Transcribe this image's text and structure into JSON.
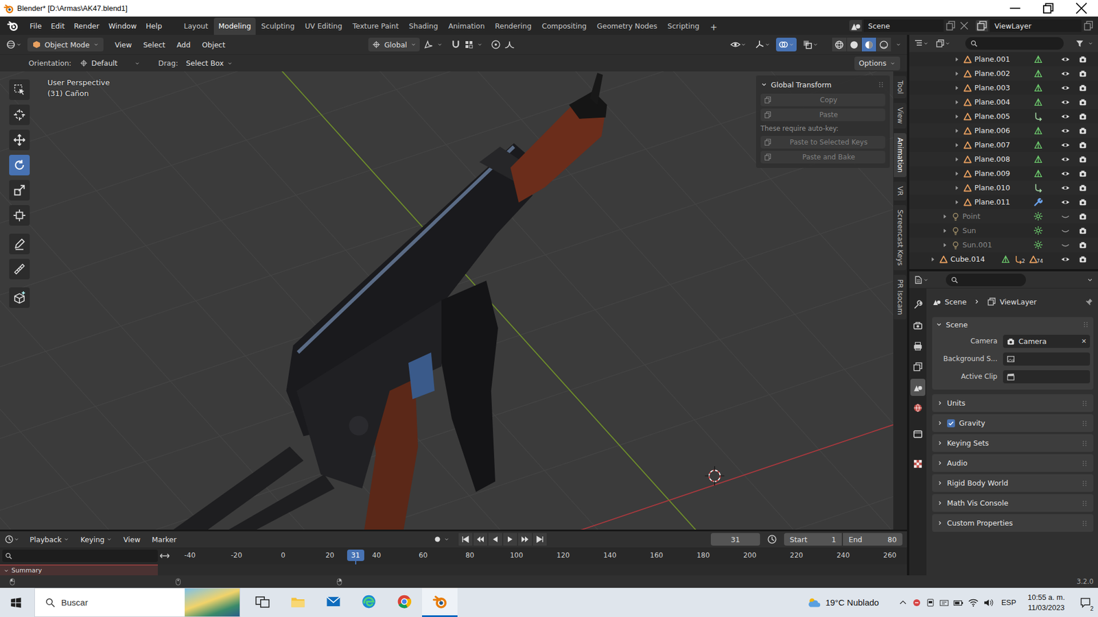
{
  "window": {
    "title": "Blender* [D:\\Armas\\AK47.blend1]"
  },
  "topbar": {
    "menus": [
      "File",
      "Edit",
      "Render",
      "Window",
      "Help"
    ],
    "workspaces": [
      {
        "label": "Layout",
        "selected": false
      },
      {
        "label": "Modeling",
        "selected": true
      },
      {
        "label": "Sculpting",
        "selected": false
      },
      {
        "label": "UV Editing",
        "selected": false
      },
      {
        "label": "Texture Paint",
        "selected": false
      },
      {
        "label": "Shading",
        "selected": false
      },
      {
        "label": "Animation",
        "selected": false
      },
      {
        "label": "Rendering",
        "selected": false
      },
      {
        "label": "Compositing",
        "selected": false
      },
      {
        "label": "Geometry Nodes",
        "selected": false
      },
      {
        "label": "Scripting",
        "selected": false
      }
    ],
    "add_workspace": "+",
    "scene": "Scene",
    "view_layer": "ViewLayer"
  },
  "viewport": {
    "mode": "Object Mode",
    "menus": [
      "View",
      "Select",
      "Add",
      "Object"
    ],
    "orientation": "Global",
    "toggles": [
      {
        "kind": "visibility",
        "on": false
      },
      {
        "kind": "gizmo",
        "on": false
      },
      {
        "kind": "overlay",
        "on": true
      },
      {
        "kind": "xray",
        "on": false
      }
    ],
    "shading": [
      {
        "kind": "wireframe",
        "selected": false
      },
      {
        "kind": "solid",
        "selected": false
      },
      {
        "kind": "material",
        "selected": true
      },
      {
        "kind": "rendered",
        "selected": false
      }
    ],
    "tool_settings": {
      "orientation_label": "Orientation:",
      "orientation": "Default",
      "drag_label": "Drag:",
      "drag": "Select Box",
      "options": "Options"
    },
    "info": [
      "User Perspective",
      "(31) Cañon"
    ],
    "tools": [
      {
        "kind": "select",
        "selected": false
      },
      {
        "kind": "cursor",
        "selected": false
      },
      {
        "kind": "move",
        "selected": false
      },
      {
        "kind": "rotate",
        "selected": true
      },
      {
        "kind": "scale",
        "selected": false
      },
      {
        "kind": "transform",
        "selected": false
      },
      {
        "kind": "annotate",
        "selected": false
      },
      {
        "kind": "measure",
        "selected": false
      },
      {
        "kind": "add-cube",
        "selected": false
      }
    ],
    "sidebar": {
      "title": "Global Transform",
      "expanded": true,
      "items": [
        {
          "kind": "button",
          "label": "Copy",
          "disabled": true
        },
        {
          "kind": "button",
          "label": "Paste",
          "disabled": true
        },
        {
          "kind": "note",
          "label": "These require auto-key:",
          "disabled": false
        },
        {
          "kind": "button",
          "label": "Paste to Selected Keys",
          "disabled": true
        },
        {
          "kind": "button",
          "label": "Paste and Bake",
          "disabled": true
        }
      ]
    },
    "tabs": [
      {
        "label": "Tool",
        "selected": false
      },
      {
        "label": "View",
        "selected": false
      },
      {
        "label": "Animation",
        "selected": true
      },
      {
        "label": "VR",
        "selected": false
      },
      {
        "label": "Screencast Keys",
        "selected": false
      },
      {
        "label": "PR Isocam",
        "selected": false
      }
    ]
  },
  "outliner": {
    "rows": [
      {
        "name": "Plane.001",
        "depth": 2,
        "kind": "mesh",
        "hidden": false,
        "badges": []
      },
      {
        "name": "Plane.002",
        "depth": 2,
        "kind": "mesh",
        "hidden": false,
        "badges": []
      },
      {
        "name": "Plane.003",
        "depth": 2,
        "kind": "mesh",
        "hidden": false,
        "badges": []
      },
      {
        "name": "Plane.004",
        "depth": 2,
        "kind": "mesh",
        "hidden": false,
        "badges": []
      },
      {
        "name": "Plane.005",
        "depth": 2,
        "kind": "hook",
        "hidden": false,
        "badges": []
      },
      {
        "name": "Plane.006",
        "depth": 2,
        "kind": "mesh",
        "hidden": false,
        "badges": []
      },
      {
        "name": "Plane.007",
        "depth": 2,
        "kind": "mesh",
        "hidden": false,
        "badges": []
      },
      {
        "name": "Plane.008",
        "depth": 2,
        "kind": "mesh",
        "hidden": false,
        "badges": []
      },
      {
        "name": "Plane.009",
        "depth": 2,
        "kind": "mesh",
        "hidden": false,
        "badges": []
      },
      {
        "name": "Plane.010",
        "depth": 2,
        "kind": "hook",
        "hidden": false,
        "badges": []
      },
      {
        "name": "Plane.011",
        "depth": 2,
        "kind": "modifier",
        "hidden": false,
        "badges": []
      },
      {
        "name": "Point",
        "depth": 1,
        "kind": "light",
        "hidden": true,
        "badges": []
      },
      {
        "name": "Sun",
        "depth": 1,
        "kind": "light",
        "hidden": true,
        "badges": []
      },
      {
        "name": "Sun.001",
        "depth": 1,
        "kind": "light",
        "hidden": true,
        "badges": []
      },
      {
        "name": "Cube.014",
        "depth": 0,
        "kind": "mesh",
        "hidden": false,
        "badges": [
          {
            "kind": "hook",
            "count": "2"
          },
          {
            "kind": "object",
            "count": "74"
          }
        ]
      }
    ]
  },
  "properties": {
    "breadcrumb": [
      "Scene",
      "ViewLayer"
    ],
    "tabs": [
      {
        "kind": "tool",
        "selected": false
      },
      {
        "kind": "render",
        "selected": false
      },
      {
        "kind": "output",
        "selected": false
      },
      {
        "kind": "view-layer",
        "selected": false
      },
      {
        "kind": "scene",
        "selected": true
      },
      {
        "kind": "world",
        "selected": false
      },
      {
        "kind": "collection",
        "selected": false
      },
      {
        "kind": "texture",
        "selected": false
      }
    ],
    "panel": {
      "title": "Scene",
      "expanded": true,
      "fields": [
        {
          "label": "Camera",
          "kind": "camera",
          "value": "Camera",
          "clear": "✕"
        },
        {
          "label": "Background S...",
          "kind": "image"
        },
        {
          "label": "Active Clip",
          "kind": "clip"
        }
      ]
    },
    "subpanels": [
      {
        "label": "Units",
        "kind": "plain",
        "expanded": false
      },
      {
        "label": "Gravity",
        "kind": "checkbox",
        "checked": true,
        "expanded": false
      },
      {
        "label": "Keying Sets",
        "kind": "plain",
        "expanded": false
      },
      {
        "label": "Audio",
        "kind": "plain",
        "expanded": false
      },
      {
        "label": "Rigid Body World",
        "kind": "plain",
        "expanded": false
      },
      {
        "label": "Math Vis Console",
        "kind": "plain",
        "expanded": false
      },
      {
        "label": "Custom Properties",
        "kind": "plain",
        "expanded": false
      }
    ]
  },
  "timeline": {
    "menus": [
      "Playback",
      "Keying",
      "View",
      "Marker"
    ],
    "frame": "31",
    "start_label": "Start",
    "start": "1",
    "end_label": "End",
    "end": "80",
    "ticks": [
      "-40",
      "-20",
      "0",
      "20",
      "40",
      "60",
      "80",
      "100",
      "120",
      "140",
      "160",
      "180",
      "200",
      "220",
      "240",
      "260"
    ],
    "playhead": "31",
    "summary": "Summary"
  },
  "status_bar": {
    "version": "3.2.0"
  },
  "taskbar": {
    "search": "Buscar",
    "apps": [
      {
        "kind": "task-view",
        "active": false
      },
      {
        "kind": "explorer",
        "active": false
      },
      {
        "kind": "mail",
        "active": false
      },
      {
        "kind": "edge",
        "active": false
      },
      {
        "kind": "chrome",
        "active": false
      },
      {
        "kind": "blender",
        "active": true
      }
    ],
    "weather": "19°C Nublado",
    "language": "ESP",
    "time": "10:55 a. m.",
    "date": "11/03/2023",
    "notifications": "2"
  }
}
